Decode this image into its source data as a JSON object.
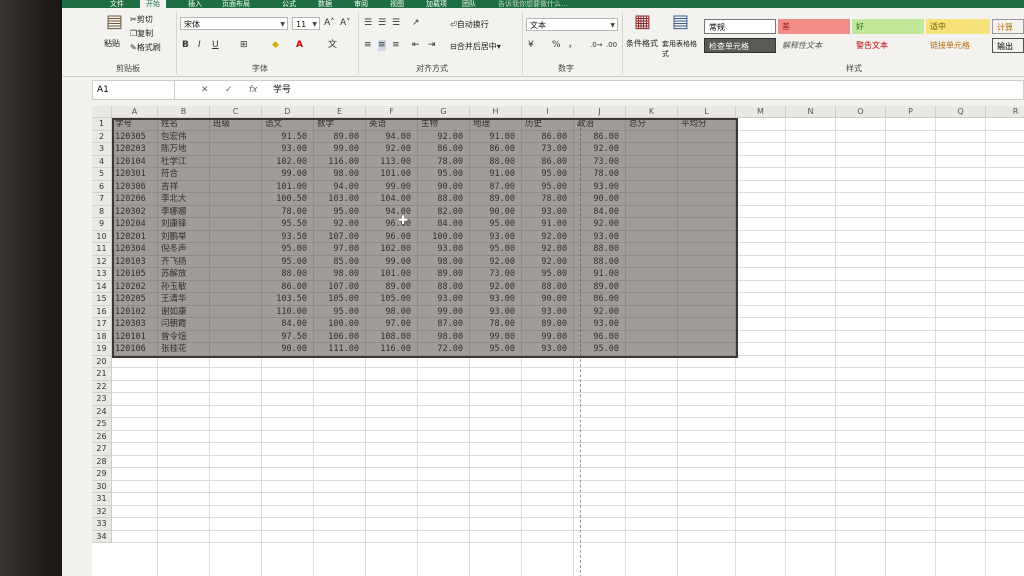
{
  "ribbon_tabs": [
    "文件",
    "开始",
    "插入",
    "页面布局",
    "公式",
    "数据",
    "审阅",
    "视图",
    "加载项",
    "团队",
    "告诉我你想要做什么..."
  ],
  "active_tab": "开始",
  "clipboard": {
    "paste": "粘贴",
    "cut": "剪切",
    "copy": "复制",
    "format_painter": "格式刷",
    "label": "剪贴板"
  },
  "font": {
    "name": "宋体",
    "size": "11",
    "grow": "A˄",
    "shrink": "A˅",
    "bold": "B",
    "italic": "I",
    "underline": "U",
    "label": "字体"
  },
  "alignment": {
    "wrap": "自动换行",
    "merge": "合并后居中",
    "label": "对齐方式"
  },
  "number": {
    "format": "文本",
    "percent": "%",
    "comma": "，",
    "label": "数字"
  },
  "styles": {
    "conditional": "条件格式",
    "table_format": "套用表格格式",
    "normal": "常规",
    "bad": "差",
    "good": "好",
    "neutral": "适中",
    "calc": "计算",
    "check_cell": "检查单元格",
    "explanatory": "解释性文本",
    "warning": "警告文本",
    "linked": "链接单元格",
    "output": "输出",
    "label": "样式"
  },
  "formula_bar": {
    "name_box": "A1",
    "cancel": "✕",
    "enter": "✓",
    "fx": "fx",
    "value": "学号"
  },
  "columns": [
    "A",
    "B",
    "C",
    "D",
    "E",
    "F",
    "G",
    "H",
    "I",
    "J",
    "K",
    "L",
    "M",
    "N",
    "O",
    "P",
    "Q",
    "R"
  ],
  "rows": [
    "1",
    "2",
    "3",
    "4",
    "5",
    "6",
    "7",
    "8",
    "9",
    "10",
    "11",
    "12",
    "13",
    "14",
    "15",
    "16",
    "17",
    "18",
    "19",
    "20",
    "21",
    "22",
    "23",
    "24",
    "25",
    "26",
    "27",
    "28",
    "29",
    "30",
    "31",
    "32",
    "33",
    "34"
  ],
  "headers": [
    "学号",
    "姓名",
    "班级",
    "语文",
    "数学",
    "英语",
    "生物",
    "地理",
    "历史",
    "政治",
    "总分",
    "平均分"
  ],
  "table": [
    [
      "120305",
      "包宏伟",
      "",
      "91.50",
      "89.00",
      "94.00",
      "92.00",
      "91.00",
      "86.00",
      "86.00"
    ],
    [
      "120203",
      "陈万地",
      "",
      "93.00",
      "99.00",
      "92.00",
      "86.00",
      "86.00",
      "73.00",
      "92.00"
    ],
    [
      "120104",
      "杜学江",
      "",
      "102.00",
      "116.00",
      "113.00",
      "78.00",
      "88.00",
      "86.00",
      "73.00"
    ],
    [
      "120301",
      "符合",
      "",
      "99.00",
      "98.00",
      "101.00",
      "95.00",
      "91.00",
      "95.00",
      "78.00"
    ],
    [
      "120306",
      "吉祥",
      "",
      "101.00",
      "94.00",
      "99.00",
      "90.00",
      "87.00",
      "95.00",
      "93.00"
    ],
    [
      "120206",
      "李北大",
      "",
      "100.50",
      "103.00",
      "104.00",
      "88.00",
      "89.00",
      "78.00",
      "90.00"
    ],
    [
      "120302",
      "李娜娜",
      "",
      "78.00",
      "95.00",
      "94.00",
      "82.00",
      "90.00",
      "93.00",
      "84.00"
    ],
    [
      "120204",
      "刘康锋",
      "",
      "95.50",
      "92.00",
      "96.00",
      "84.00",
      "95.00",
      "91.00",
      "92.00"
    ],
    [
      "120201",
      "刘鹏举",
      "",
      "93.50",
      "107.00",
      "96.00",
      "100.00",
      "93.00",
      "92.00",
      "93.00"
    ],
    [
      "120304",
      "倪冬声",
      "",
      "95.00",
      "97.00",
      "102.00",
      "93.00",
      "95.00",
      "92.00",
      "88.00"
    ],
    [
      "120103",
      "齐飞扬",
      "",
      "95.00",
      "85.00",
      "99.00",
      "98.00",
      "92.00",
      "92.00",
      "88.00"
    ],
    [
      "120105",
      "苏解放",
      "",
      "88.00",
      "98.00",
      "101.00",
      "89.00",
      "73.00",
      "95.00",
      "91.00"
    ],
    [
      "120202",
      "孙玉敏",
      "",
      "86.00",
      "107.00",
      "89.00",
      "88.00",
      "92.00",
      "88.00",
      "89.00"
    ],
    [
      "120205",
      "王清华",
      "",
      "103.50",
      "105.00",
      "105.00",
      "93.00",
      "93.00",
      "90.00",
      "86.00"
    ],
    [
      "120102",
      "谢如康",
      "",
      "110.00",
      "95.00",
      "98.00",
      "99.00",
      "93.00",
      "93.00",
      "92.00"
    ],
    [
      "120303",
      "闫朝霞",
      "",
      "84.00",
      "100.00",
      "97.00",
      "87.00",
      "78.00",
      "89.00",
      "93.00"
    ],
    [
      "120101",
      "曾令煊",
      "",
      "97.50",
      "106.00",
      "108.00",
      "98.00",
      "99.00",
      "99.00",
      "96.00"
    ],
    [
      "120106",
      "张桂花",
      "",
      "90.00",
      "111.00",
      "116.00",
      "72.00",
      "95.00",
      "93.00",
      "95.00"
    ]
  ]
}
